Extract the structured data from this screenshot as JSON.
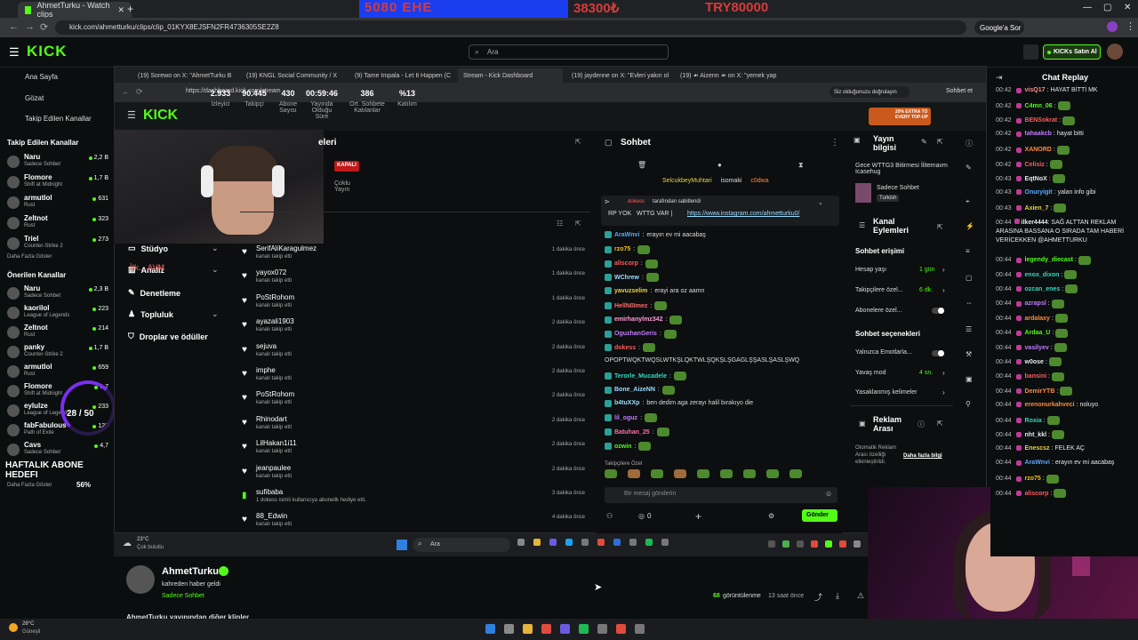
{
  "outer_browser": {
    "active_tab": "AhmetTurku - Watch clips",
    "address": "kick.com/ahmetturku/clips/clip_01KYX8EJSFN2FR4736305SE2Z8",
    "google_label": "Google'a Sor",
    "overlay_text_left": "5080 EHE",
    "overlay_text_mid": "38300₺",
    "overlay_text_right": "TRY80000"
  },
  "kick_header": {
    "logo": "KICK",
    "search_placeholder": "Ara",
    "buy_kicks": "KICKs Satın Al"
  },
  "left_sidebar": {
    "home": "Ana Sayfa",
    "browse": "Gözat",
    "following_link": "Takip Edilen Kanallar",
    "following_title": "Takip Edilen Kanallar",
    "following": [
      {
        "name": "Naru",
        "cat": "Sadece Sohbet",
        "viewers": "2,2 B"
      },
      {
        "name": "Flomore",
        "cat": "Shift at Midnight",
        "viewers": "1,7 B"
      },
      {
        "name": "armutlol",
        "cat": "Rust",
        "viewers": "631"
      },
      {
        "name": "Zeltnot",
        "cat": "Rust",
        "viewers": "323"
      },
      {
        "name": "Triel",
        "cat": "Counter-Strike 2",
        "viewers": "273"
      }
    ],
    "more1": "Daha Fazla Göster",
    "recommended_title": "Önerilen Kanallar",
    "recommended": [
      {
        "name": "Naru",
        "cat": "Sadece Sohbet",
        "viewers": "2,3 B"
      },
      {
        "name": "kaorilol",
        "cat": "League of Legends",
        "viewers": "223"
      },
      {
        "name": "Zeltnot",
        "cat": "Rust",
        "viewers": "214"
      },
      {
        "name": "panky",
        "cat": "Counter-Strike 2",
        "viewers": "1,7 B"
      },
      {
        "name": "armutlol",
        "cat": "Rust",
        "viewers": "659"
      },
      {
        "name": "Flomore",
        "cat": "Shift at Midnight",
        "viewers": "1,7"
      },
      {
        "name": "eylulze",
        "cat": "League of Legends",
        "viewers": "233"
      },
      {
        "name": "fabFabulous",
        "cat": "Path of Exile",
        "viewers": "123"
      },
      {
        "name": "Cavs",
        "cat": "Sadece Sohbet",
        "viewers": "4,7"
      }
    ],
    "more2": "Daha Fazla Göster",
    "goal_count": "28 / 50",
    "goal_title": "HAFTALIK ABONE HEDEFI",
    "goal_pct": "56%"
  },
  "inner_browser": {
    "tabs": [
      "(19) Sorewo on X: \"AhmetTurku B",
      "(19) KNGL Social Community / X",
      "(9) Tame Impala - Let It Happen (C",
      "Stream - Kick Dashboard",
      "(19) jaydenne on X: \"Evleri yakın ol",
      "(19) ☙ Aizenn ☙ on X: \"yemek yap"
    ],
    "address": "https://dashboard.kick.com/stream",
    "verify_label": "Siz olduğunuzu doğrulayın",
    "chat_label": "Sohbet et"
  },
  "dashboard": {
    "section_title": "eleri",
    "status": "KAPALI",
    "multi": "Çoklu Yayın",
    "stats": [
      {
        "value": "2.933",
        "label": "İzleyici"
      },
      {
        "value": "90.445",
        "label": "Takipçi"
      },
      {
        "value": "430",
        "label": "Abone Sayısı"
      },
      {
        "value": "00:59:46",
        "label": "Yayında Olduğu Süre"
      },
      {
        "value": "386",
        "label": "Ort. Sohbete Katılanlar"
      },
      {
        "value": "%13",
        "label": "Katılım"
      }
    ],
    "menu": [
      "Stüdyo",
      "Analiz",
      "Denetleme",
      "Topluluk",
      "Droplar ve ödüller"
    ],
    "menu_overlay": "İlk... AVM",
    "activity": [
      {
        "name": "SerifAliKaragulmez",
        "sub": "kanalı takip etti",
        "time": "1 dakika önce"
      },
      {
        "name": "yayox072",
        "sub": "kanalı takip etti",
        "time": "1 dakika önce"
      },
      {
        "name": "PoStRohom",
        "sub": "kanalı takip etti",
        "time": "1 dakika önce"
      },
      {
        "name": "ayazali1903",
        "sub": "kanalı takip etti",
        "time": "2 dakika önce"
      },
      {
        "name": "sejuva",
        "sub": "kanalı takip etti",
        "time": "2 dakika önce"
      },
      {
        "name": "imphe",
        "sub": "kanalı takip etti",
        "time": "2 dakika önce"
      },
      {
        "name": "PoStRohom",
        "sub": "kanalı takip etti",
        "time": "2 dakika önce"
      },
      {
        "name": "Rhinodart",
        "sub": "kanalı takip etti",
        "time": "2 dakika önce"
      },
      {
        "name": "LilHakan1i11",
        "sub": "kanalı takip etti",
        "time": "2 dakika önce"
      },
      {
        "name": "jeanpaulee",
        "sub": "kanalı takip etti",
        "time": "2 dakika önce"
      },
      {
        "name": "sufibaba",
        "sub": "1 dokess isimli kullanıcıya abonelik hediye etti.",
        "time": "3 dakika önce",
        "gift": true
      },
      {
        "name": "88_Edwin",
        "sub": "kanalı takip etti",
        "time": "4 dakika önce"
      }
    ]
  },
  "chat": {
    "title": "Sohbet",
    "top_users": [
      "SelcukbeyMuhtari",
      "isomaki",
      "c0dwa"
    ],
    "pin_by": "dokess",
    "pin_suffix": "tarafından sabitlendi",
    "pin_text": "RP YOK",
    "pin_text2": "WTTG VAR |",
    "pin_link": "https://www.instagram.com/ahmetturku0/",
    "messages": [
      {
        "user": "AraWnvi",
        "color": "#5aa9ff",
        "text": "erayın ev mi aacabaş"
      },
      {
        "user": "rzo75",
        "color": "#f0c419",
        "text": ""
      },
      {
        "user": "aliscorp",
        "color": "#ff5b5b",
        "text": ""
      },
      {
        "user": "WChrew",
        "color": "#9bdcff",
        "text": ""
      },
      {
        "user": "yavuzselim",
        "color": "#e8d24a",
        "text": "erayi ara oz aamn"
      },
      {
        "user": "HellN0Imez",
        "color": "#ff6b6b",
        "text": ""
      },
      {
        "user": "emirhanylmz342",
        "color": "#ff9bd5",
        "text": ""
      },
      {
        "user": "OguzhanGeris",
        "color": "#c07bff",
        "text": ""
      },
      {
        "user": "dokess",
        "color": "#ff5b5b",
        "text": ""
      },
      {
        "user": "",
        "color": "#ddd",
        "text": "OPOPTWQKTWQSLWTKŞLQKTWLŞQKŞLŞGAGLŞŞASLŞASLŞWQ"
      },
      {
        "user": "Terorle_Mucadele",
        "color": "#33d6c1",
        "text": ""
      },
      {
        "user": "Bone_AizeNN",
        "color": "#9bdcff",
        "text": ""
      },
      {
        "user": "b4tuXXp",
        "color": "#9bdcff",
        "text": "ben dedim aga zerayı halil bırakıyo die"
      },
      {
        "user": "lil_oguz",
        "color": "#c07bff",
        "text": ""
      },
      {
        "user": "Batuhan_25",
        "color": "#ff6fa3",
        "text": ""
      },
      {
        "user": "ozwin",
        "color": "#53fc18",
        "text": ""
      }
    ],
    "followers_only": "Takipçilere Özel",
    "input_placeholder": "Bir mesaj gönderin",
    "count": "0",
    "send": "Gönder"
  },
  "right_panel": {
    "stream_info_title": "Yayın bilgisi",
    "stream_title": "Gece WTTG3 Bitirmesi İlitemavm Icasehug",
    "category": "Sadece Sohbet",
    "tag": "Turkish",
    "channel_events": "Kanal Eylemleri",
    "chat_access": "Sohbet erişimi",
    "account_age": "Hesap yaşı",
    "account_age_val": "1 gün",
    "followers_only": "Takipçilere özel...",
    "followers_only_val": "6 dk.",
    "subs_only": "Abonelere özel...",
    "chat_options": "Sohbet seçenekleri",
    "emotes_only": "Yalnızca Emotlarla...",
    "slow_mode": "Yavaş mod",
    "slow_mode_val": "4 sn.",
    "banned_words": "Yasaklanmış kelimeler",
    "ad_break": "Reklam Arası",
    "ad_text": "Otomatik Reklam Arası özelliği etkinleştirildi.",
    "ad_more": "Daha fazla bilgi",
    "promo": "20% EXTRA TO EVERY TOP-UP"
  },
  "inner_taskbar": {
    "weather_temp": "23°C",
    "weather_text": "Çok bulutlu",
    "search": "Ara"
  },
  "channel_info": {
    "name": "AhmetTurku",
    "subtitle": "kahreden haber geldi",
    "category": "Sadece Sohbet",
    "views": "68",
    "views_label": "görüntülenme",
    "ago": "13 saat önce",
    "more": "AhmetTurku yayınından diğer klipler"
  },
  "chat_replay": {
    "title": "Chat Replay",
    "messages": [
      {
        "time": "00:42",
        "user": "visQ17",
        "color": "#ff8a8a",
        "text": "HAYAT BİTTİ MK"
      },
      {
        "time": "00:42",
        "user": "C4mn_06",
        "color": "#53fc18",
        "text": ""
      },
      {
        "time": "00:42",
        "user": "BENSokrat",
        "color": "#ff5b5b",
        "text": ""
      },
      {
        "time": "00:42",
        "user": "tahaakcb",
        "color": "#c07bff",
        "text": "hayat bitti"
      },
      {
        "time": "00:42",
        "user": "XANORD",
        "color": "#ff8a3d",
        "text": ""
      },
      {
        "time": "00:42",
        "user": "Celisiz",
        "color": "#ff5b5b",
        "text": ""
      },
      {
        "time": "00:43",
        "user": "EqtNoX",
        "color": "#e8e8e8",
        "text": ""
      },
      {
        "time": "00:43",
        "user": "Onuryigit",
        "color": "#5aa9ff",
        "text": "yalan info gibi"
      },
      {
        "time": "00:43",
        "user": "Axien_7",
        "color": "#e8d24a",
        "text": ""
      },
      {
        "time": "00:44",
        "user": "ilker4444",
        "color": "#e8e8e8",
        "text": "SAĞ ALTTAN REKLAM ARASINA BASSANA O SIRADA TAM HABERİ VERİCEKKEN @AHMETTURKU"
      },
      {
        "time": "00:44",
        "user": "legendy_diecast",
        "color": "#53fc18",
        "text": ""
      },
      {
        "time": "00:44",
        "user": "enox_dixon",
        "color": "#33d6c1",
        "text": ""
      },
      {
        "time": "00:44",
        "user": "ozcan_enes",
        "color": "#33d6c1",
        "text": ""
      },
      {
        "time": "00:44",
        "user": "azrapsl",
        "color": "#c07bff",
        "text": ""
      },
      {
        "time": "00:44",
        "user": "ardalaxy",
        "color": "#ff8a3d",
        "text": ""
      },
      {
        "time": "00:44",
        "user": "Ardaa_U",
        "color": "#53fc18",
        "text": ""
      },
      {
        "time": "00:44",
        "user": "vasilyev",
        "color": "#c07bff",
        "text": ""
      },
      {
        "time": "00:44",
        "user": "w0ose",
        "color": "#e8e8e8",
        "text": ""
      },
      {
        "time": "00:44",
        "user": "bansini",
        "color": "#ff5b5b",
        "text": ""
      },
      {
        "time": "00:44",
        "user": "DemirYTB",
        "color": "#ff8a3d",
        "text": ""
      },
      {
        "time": "00:44",
        "user": "erenonurkahveci",
        "color": "#ff8a3d",
        "text": "noluyo"
      },
      {
        "time": "00:44",
        "user": "Roxia",
        "color": "#33d6c1",
        "text": ""
      },
      {
        "time": "00:44",
        "user": "nht_kkl",
        "color": "#e8e8e8",
        "text": ""
      },
      {
        "time": "00:44",
        "user": "Enescsz",
        "color": "#e8d24a",
        "text": "FELEK AÇ"
      },
      {
        "time": "00:44",
        "user": "AraWnvi",
        "color": "#5aa9ff",
        "text": "erayın ev mi aacabaş"
      },
      {
        "time": "00:44",
        "user": "rzo75",
        "color": "#f0c419",
        "text": ""
      },
      {
        "time": "00:44",
        "user": "aliscorp",
        "color": "#ff5b5b",
        "text": ""
      }
    ]
  },
  "outer_taskbar": {
    "temp": "28°C",
    "weather": "Güneşli"
  }
}
